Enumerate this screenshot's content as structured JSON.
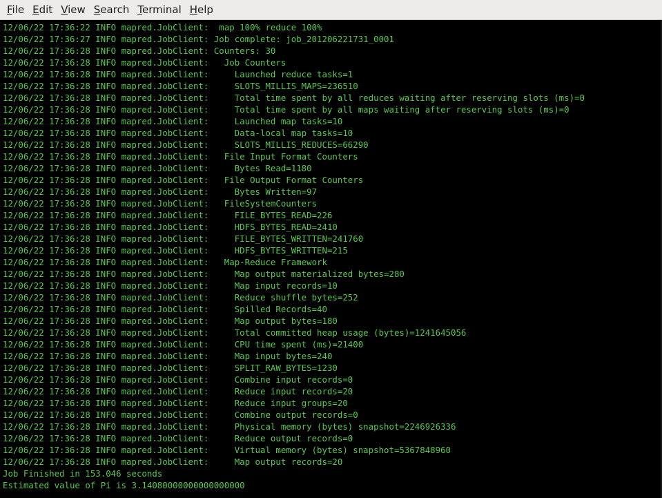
{
  "menubar": {
    "items": [
      {
        "name": "menu-file",
        "mnemonic": "F",
        "rest": "ile"
      },
      {
        "name": "menu-edit",
        "mnemonic": "E",
        "rest": "dit"
      },
      {
        "name": "menu-view",
        "mnemonic": "V",
        "rest": "iew"
      },
      {
        "name": "menu-search",
        "mnemonic": "S",
        "rest": "earch"
      },
      {
        "name": "menu-terminal",
        "mnemonic": "T",
        "rest": "erminal"
      },
      {
        "name": "menu-help",
        "mnemonic": "H",
        "rest": "elp"
      }
    ]
  },
  "terminal": {
    "text_color": "#5ac84f",
    "background": "#000000",
    "lines": [
      "12/06/22 17:36:22 INFO mapred.JobClient:  map 100% reduce 100%",
      "12/06/22 17:36:27 INFO mapred.JobClient: Job complete: job_201206221731_0001",
      "12/06/22 17:36:28 INFO mapred.JobClient: Counters: 30",
      "12/06/22 17:36:28 INFO mapred.JobClient:   Job Counters",
      "12/06/22 17:36:28 INFO mapred.JobClient:     Launched reduce tasks=1",
      "12/06/22 17:36:28 INFO mapred.JobClient:     SLOTS_MILLIS_MAPS=236510",
      "12/06/22 17:36:28 INFO mapred.JobClient:     Total time spent by all reduces waiting after reserving slots (ms)=0",
      "12/06/22 17:36:28 INFO mapred.JobClient:     Total time spent by all maps waiting after reserving slots (ms)=0",
      "12/06/22 17:36:28 INFO mapred.JobClient:     Launched map tasks=10",
      "12/06/22 17:36:28 INFO mapred.JobClient:     Data-local map tasks=10",
      "12/06/22 17:36:28 INFO mapred.JobClient:     SLOTS_MILLIS_REDUCES=66290",
      "12/06/22 17:36:28 INFO mapred.JobClient:   File Input Format Counters",
      "12/06/22 17:36:28 INFO mapred.JobClient:     Bytes Read=1180",
      "12/06/22 17:36:28 INFO mapred.JobClient:   File Output Format Counters",
      "12/06/22 17:36:28 INFO mapred.JobClient:     Bytes Written=97",
      "12/06/22 17:36:28 INFO mapred.JobClient:   FileSystemCounters",
      "12/06/22 17:36:28 INFO mapred.JobClient:     FILE_BYTES_READ=226",
      "12/06/22 17:36:28 INFO mapred.JobClient:     HDFS_BYTES_READ=2410",
      "12/06/22 17:36:28 INFO mapred.JobClient:     FILE_BYTES_WRITTEN=241760",
      "12/06/22 17:36:28 INFO mapred.JobClient:     HDFS_BYTES_WRITTEN=215",
      "12/06/22 17:36:28 INFO mapred.JobClient:   Map-Reduce Framework",
      "12/06/22 17:36:28 INFO mapred.JobClient:     Map output materialized bytes=280",
      "12/06/22 17:36:28 INFO mapred.JobClient:     Map input records=10",
      "12/06/22 17:36:28 INFO mapred.JobClient:     Reduce shuffle bytes=252",
      "12/06/22 17:36:28 INFO mapred.JobClient:     Spilled Records=40",
      "12/06/22 17:36:28 INFO mapred.JobClient:     Map output bytes=180",
      "12/06/22 17:36:28 INFO mapred.JobClient:     Total committed heap usage (bytes)=1241645056",
      "12/06/22 17:36:28 INFO mapred.JobClient:     CPU time spent (ms)=21400",
      "12/06/22 17:36:28 INFO mapred.JobClient:     Map input bytes=240",
      "12/06/22 17:36:28 INFO mapred.JobClient:     SPLIT_RAW_BYTES=1230",
      "12/06/22 17:36:28 INFO mapred.JobClient:     Combine input records=0",
      "12/06/22 17:36:28 INFO mapred.JobClient:     Reduce input records=20",
      "12/06/22 17:36:28 INFO mapred.JobClient:     Reduce input groups=20",
      "12/06/22 17:36:28 INFO mapred.JobClient:     Combine output records=0",
      "12/06/22 17:36:28 INFO mapred.JobClient:     Physical memory (bytes) snapshot=2246926336",
      "12/06/22 17:36:28 INFO mapred.JobClient:     Reduce output records=0",
      "12/06/22 17:36:28 INFO mapred.JobClient:     Virtual memory (bytes) snapshot=5367848960",
      "12/06/22 17:36:28 INFO mapred.JobClient:     Map output records=20",
      "Job Finished in 153.046 seconds",
      "Estimated value of Pi is 3.14080000000000000000"
    ]
  }
}
